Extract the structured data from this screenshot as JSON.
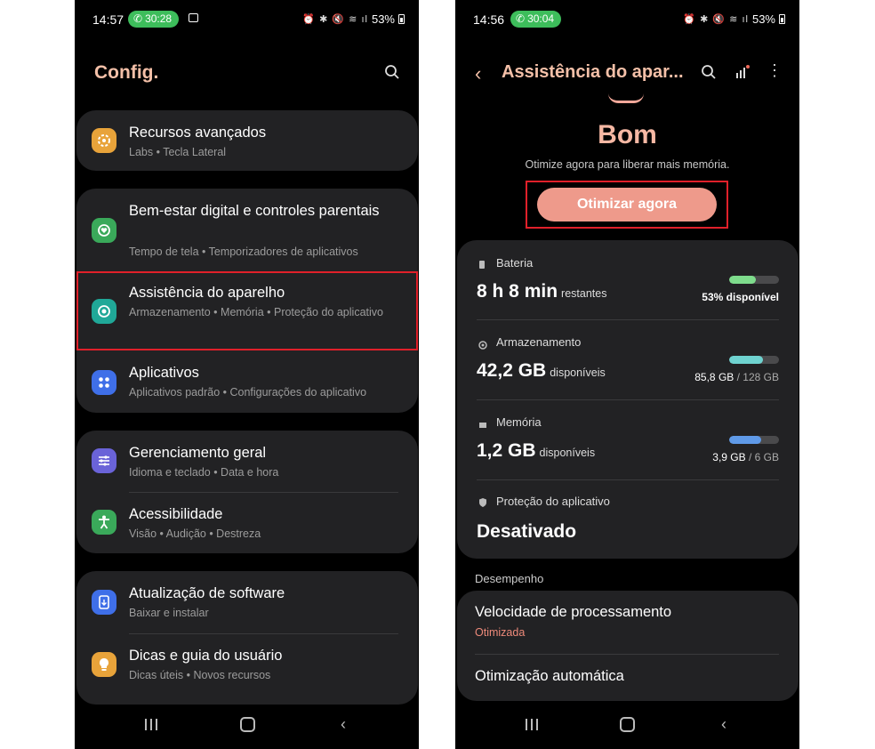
{
  "left": {
    "status": {
      "time": "14:57",
      "call": "30:28",
      "battery": "53%"
    },
    "title": "Config.",
    "groups": [
      {
        "items": [
          {
            "title": "Recursos avançados",
            "subtitle": "Labs • Tecla Lateral",
            "icon": "star-gear-icon",
            "color": "#e8a33a"
          }
        ]
      },
      {
        "items": [
          {
            "title": "Bem-estar digital e controles parentais",
            "subtitle": "Tempo de tela • Temporizadores de aplicativos",
            "icon": "heart-circle-icon",
            "color": "#3aa95a"
          },
          {
            "title": "Assistência do aparelho",
            "subtitle": "Armazenamento • Memória • Proteção do aplicativo",
            "icon": "device-care-icon",
            "color": "#20a898"
          },
          {
            "title": "Aplicativos",
            "subtitle": "Aplicativos padrão • Configurações do aplicativo",
            "icon": "apps-grid-icon",
            "color": "#3f6fe8"
          }
        ]
      },
      {
        "items": [
          {
            "title": "Gerenciamento geral",
            "subtitle": "Idioma e teclado • Data e hora",
            "icon": "sliders-icon",
            "color": "#6a63d8"
          },
          {
            "title": "Acessibilidade",
            "subtitle": "Visão • Audição • Destreza",
            "icon": "accessibility-icon",
            "color": "#3aa95a"
          }
        ]
      },
      {
        "items": [
          {
            "title": "Atualização de software",
            "subtitle": "Baixar e instalar",
            "icon": "update-icon",
            "color": "#3f6fe8"
          },
          {
            "title": "Dicas e guia do usuário",
            "subtitle": "Dicas úteis • Novos recursos",
            "icon": "lightbulb-icon",
            "color": "#e8a33a"
          }
        ]
      }
    ]
  },
  "right": {
    "status": {
      "time": "14:56",
      "call": "30:04",
      "battery": "53%"
    },
    "title": "Assistência do apar...",
    "status_word": "Bom",
    "status_sub": "Otimize agora para liberar mais memória.",
    "optimize_label": "Otimizar agora",
    "battery": {
      "label": "Bateria",
      "value": "8 h 8 min",
      "unit": "restantes",
      "detail": "53% disponível",
      "level": 0.53,
      "color": "#7edc8c"
    },
    "storage": {
      "label": "Armazenamento",
      "value": "42,2 GB",
      "unit": "disponíveis",
      "used": "85,8 GB",
      "total": "/ 128 GB",
      "level": 0.67,
      "color": "#6fd3d0"
    },
    "memory": {
      "label": "Memória",
      "value": "1,2 GB",
      "unit": "disponíveis",
      "used": "3,9 GB",
      "total": "/ 6 GB",
      "level": 0.65,
      "color": "#5f9ae8"
    },
    "protection": {
      "label": "Proteção do aplicativo",
      "value": "Desativado"
    },
    "performance_header": "Desempenho",
    "performance": [
      {
        "title": "Velocidade de processamento",
        "subtitle": "Otimizada"
      },
      {
        "title": "Otimização automática"
      }
    ]
  }
}
